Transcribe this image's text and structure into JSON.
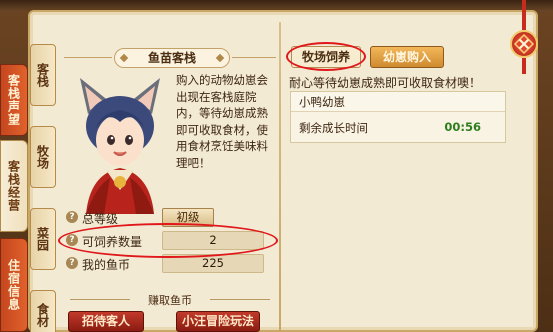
{
  "outer_tabs": [
    {
      "label": "客栈声望",
      "active": false
    },
    {
      "label": "客栈经营",
      "active": true
    },
    {
      "label": "住宿信息",
      "active": false
    }
  ],
  "inner_tabs": [
    {
      "label": "客栈"
    },
    {
      "label": "牧场"
    },
    {
      "label": "菜园"
    },
    {
      "label": "食材"
    }
  ],
  "inn": {
    "title": "鱼苗客栈",
    "description": "购入的动物幼崽会出现在客栈庭院内，等待幼崽成熟即可收取食材，使用食材烹饪美味料理吧！"
  },
  "stats": {
    "total_level": {
      "label": "总等级",
      "value": "初级"
    },
    "raise_count": {
      "label": "可饲养数量",
      "value": "2"
    },
    "coins": {
      "label": "我的鱼币",
      "value": "225"
    }
  },
  "earn": {
    "label": "赚取鱼币",
    "buttons": [
      "招待客人",
      "小汪冒险玩法"
    ]
  },
  "right": {
    "tabs": [
      {
        "label": "牧场饲养",
        "active": true
      },
      {
        "label": "幼崽购入",
        "active": false
      }
    ],
    "hint": "耐心等待幼崽成熟即可收取食材噢！",
    "animal": {
      "name": "小鸭幼崽",
      "remaining_label": "剩余成长时间",
      "remaining_time": "00:56"
    }
  },
  "colors": {
    "highlight_ring": "#e0181b",
    "accent_red": "#c13a2a",
    "timer_green": "#2e7d1e"
  }
}
